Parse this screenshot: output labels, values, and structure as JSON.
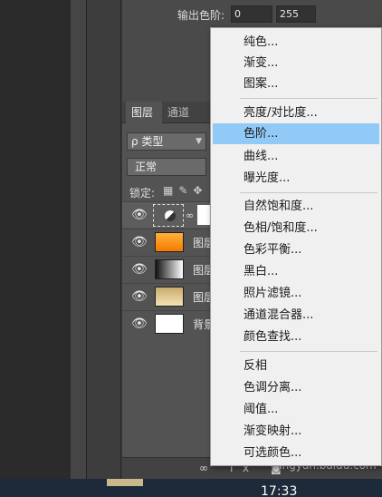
{
  "properties": {
    "output_label": "输出色阶:",
    "output_min": "0",
    "output_max": "255"
  },
  "layers_panel": {
    "tabs": [
      "图层",
      "通道"
    ],
    "kind_filter": "ρ 类型",
    "blend_mode": "正常",
    "lock_label": "锁定:",
    "layers": [
      {
        "name": "",
        "type": "adjustment"
      },
      {
        "name": "图层",
        "type": "orange"
      },
      {
        "name": "图层",
        "type": "gradient"
      },
      {
        "name": "图层",
        "type": "gold"
      },
      {
        "name": "背景",
        "type": "white"
      }
    ]
  },
  "menu": {
    "items": [
      "纯色...",
      "渐变...",
      "图案...",
      "亮度/对比度...",
      "色阶...",
      "曲线...",
      "曝光度...",
      "自然饱和度...",
      "色相/饱和度...",
      "色彩平衡...",
      "黑白...",
      "照片滤镜...",
      "通道混合器...",
      "颜色查找...",
      "反相",
      "色调分离...",
      "阈值...",
      "渐变映射...",
      "可选颜色..."
    ],
    "highlighted": "色阶..."
  },
  "footer": {
    "fx_label": "fx"
  },
  "taskbar": {
    "time": "17:33"
  },
  "watermark": "jingyan.baidu.com",
  "colors": {
    "menu_highlight": "#91c9f7",
    "orange": "#f7931e",
    "gold": "#d8c08a"
  }
}
